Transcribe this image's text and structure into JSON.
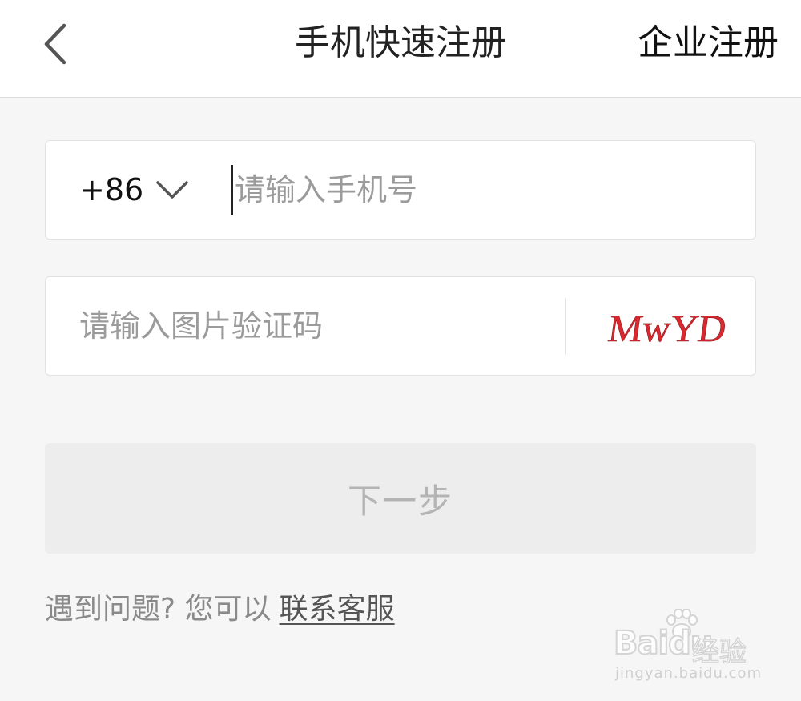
{
  "header": {
    "title": "手机快速注册",
    "right_link": "企业注册"
  },
  "phone_field": {
    "country_code": "+86",
    "placeholder": "请输入手机号",
    "value": ""
  },
  "captcha_field": {
    "placeholder": "请输入图片验证码",
    "value": "",
    "captcha_text": "MwYD"
  },
  "next_button": {
    "label": "下一步"
  },
  "help": {
    "text": "遇到问题? 您可以",
    "link": "联系客服"
  },
  "watermark": {
    "logo": "Baidu",
    "suffix": "经验",
    "url": "jingyan.baidu.com"
  },
  "colors": {
    "captcha_red": "#d9282f",
    "disabled_button_bg": "#ededed",
    "disabled_button_text": "#b4b4b4"
  }
}
